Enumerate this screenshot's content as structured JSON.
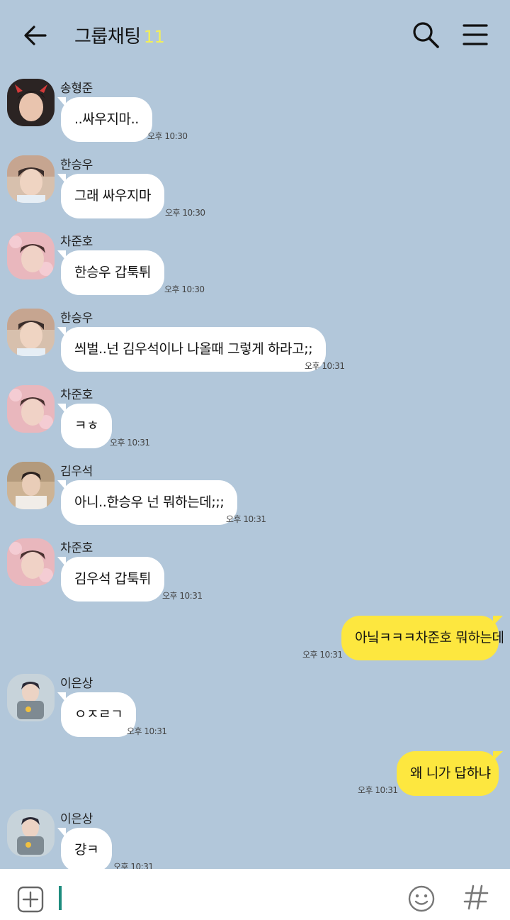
{
  "header": {
    "back_icon": "arrow-left-icon",
    "title": "그룹채팅",
    "member_count": "11",
    "search_icon": "search-icon",
    "menu_icon": "hamburger-menu-icon"
  },
  "colors": {
    "background": "#b2c7da",
    "my_bubble": "#fde73f",
    "their_bubble": "#ffffff",
    "count": "#f2ef5a",
    "caret": "#1e8c7e"
  },
  "messages": [
    {
      "sender": "송형준",
      "text": "..싸우지마..",
      "time": "오후 10:30"
    },
    {
      "sender": "한승우",
      "text": "그래 싸우지마",
      "time": "오후 10:30"
    },
    {
      "sender": "차준호",
      "text": "한승우 갑툭튀",
      "time": "오후 10:30"
    },
    {
      "sender": "한승우",
      "text": "씌벌..넌 김우석이나 나올때 그렇게 하라고;;",
      "time": "오후 10:31"
    },
    {
      "sender": "차준호",
      "text": "ㅋㅎ",
      "time": "오후 10:31"
    },
    {
      "sender": "김우석",
      "text": "아니..한승우 넌 뭐하는데;;;",
      "time": "오후 10:31"
    },
    {
      "sender": "차준호",
      "text": "김우석 갑툭튀",
      "time": "오후 10:31"
    },
    {
      "sender": "me",
      "text": "아닠ㅋㅋㅋ차준호 뭐하는데",
      "time": "오후 10:31"
    },
    {
      "sender": "이은상",
      "text": "ㅇㅈㄹㄱ",
      "time": "오후 10:31"
    },
    {
      "sender": "me",
      "text": "왜 니가 답하냐",
      "time": "오후 10:31"
    },
    {
      "sender": "이은상",
      "text": "걍ㅋ",
      "time": "오후 10:31"
    }
  ],
  "input_bar": {
    "plus_icon": "plus-square-icon",
    "emoji_icon": "smiley-icon",
    "hash_icon": "hash-icon"
  }
}
